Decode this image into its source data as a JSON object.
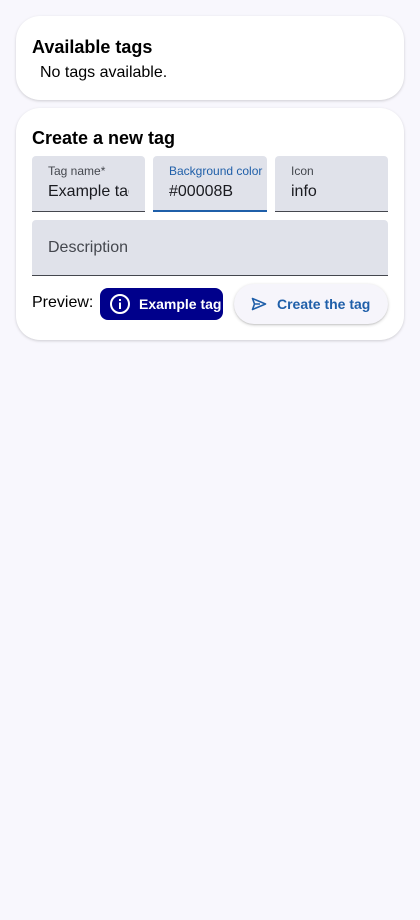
{
  "available_tags": {
    "title": "Available tags",
    "empty_message": "No tags available."
  },
  "create_tag": {
    "title": "Create a new tag",
    "name_field": {
      "label": "Tag name*",
      "value": "Example tag"
    },
    "color_field": {
      "label": "Background color",
      "value": "#00008B",
      "focused": true
    },
    "icon_field": {
      "label": "Icon",
      "value": "info"
    },
    "description_field": {
      "placeholder": "Description",
      "value": ""
    },
    "preview_label": "Preview:",
    "preview_chip": {
      "label": "Example tag",
      "icon": "info-icon",
      "background": "#00008B",
      "text_color": "#FFFFFF"
    },
    "submit_button": {
      "label": "Create the tag",
      "icon": "send-icon"
    }
  },
  "colors": {
    "page_background": "#f8f7fd",
    "card_background": "#ffffff",
    "field_background": "#e0e2ea",
    "accent": "#1f5fa9"
  }
}
